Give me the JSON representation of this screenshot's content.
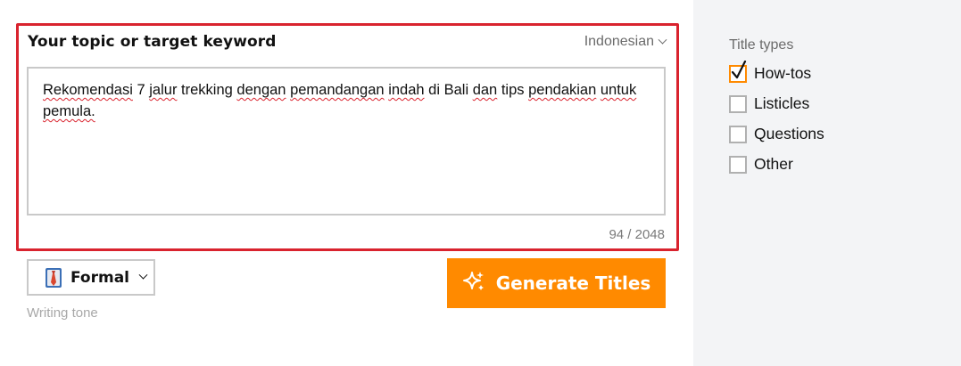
{
  "topic": {
    "title": "Your topic or target keyword",
    "language": "Indonesian",
    "text_words": [
      "Rekomendasi",
      "7",
      "jalur",
      "trekking",
      "dengan",
      "pemandangan",
      "indah",
      "di",
      "Bali",
      "dan",
      "tips",
      "pendakian",
      "untuk",
      "pemula."
    ],
    "char_count": "94 / 2048"
  },
  "tone": {
    "value": "Formal",
    "caption": "Writing tone"
  },
  "generate": {
    "label": "Generate Titles"
  },
  "title_types": {
    "heading": "Title types",
    "items": [
      {
        "label": "How-tos",
        "checked": true
      },
      {
        "label": "Listicles",
        "checked": false
      },
      {
        "label": "Questions",
        "checked": false
      },
      {
        "label": "Other",
        "checked": false
      }
    ]
  },
  "colors": {
    "accent": "#ff8a00",
    "highlight_border": "#d9232e",
    "sidebar_bg": "#f3f4f6"
  }
}
